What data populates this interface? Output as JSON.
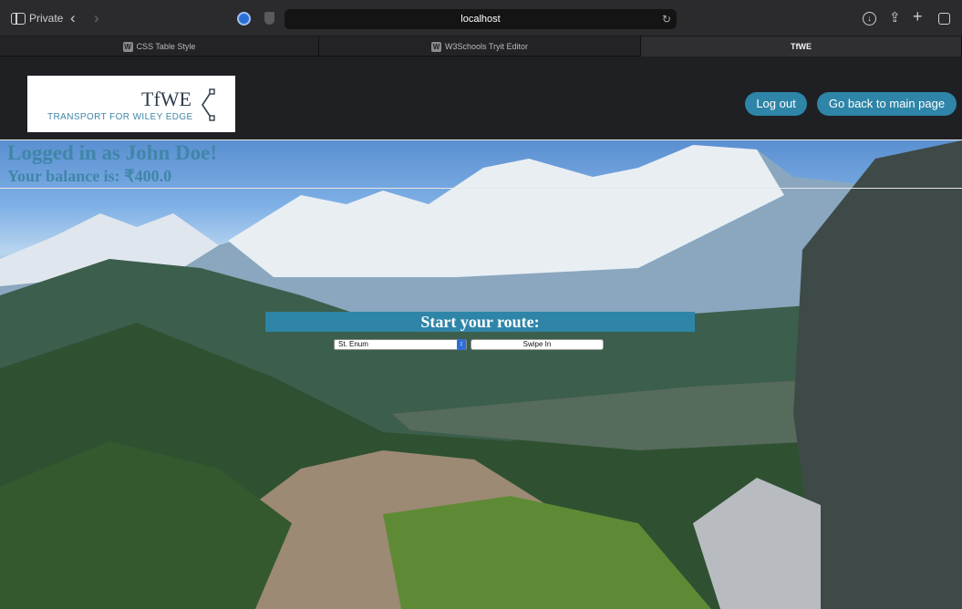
{
  "browser": {
    "private_label": "Private",
    "url": "localhost",
    "tabs": [
      {
        "label": "CSS Table Style",
        "favicon": "W"
      },
      {
        "label": "W3Schools Tryit Editor",
        "favicon": "W"
      },
      {
        "label": "TfWE"
      }
    ]
  },
  "header": {
    "logo_title": "TfWE",
    "logo_subtitle": "TRANSPORT FOR WILEY EDGE",
    "logout_label": "Log out",
    "main_page_label": "Go back to main page"
  },
  "user": {
    "logged_in_text": "Logged in as John Doe!",
    "balance_text": "Your balance is: ₹400.0"
  },
  "route": {
    "heading": "Start your route:",
    "selected_station": "St. Enum",
    "swipe_label": "Swipe In"
  },
  "colors": {
    "accent": "#2e85a8",
    "heading_text": "#3f86a8",
    "page_bg": "#1f2023"
  }
}
